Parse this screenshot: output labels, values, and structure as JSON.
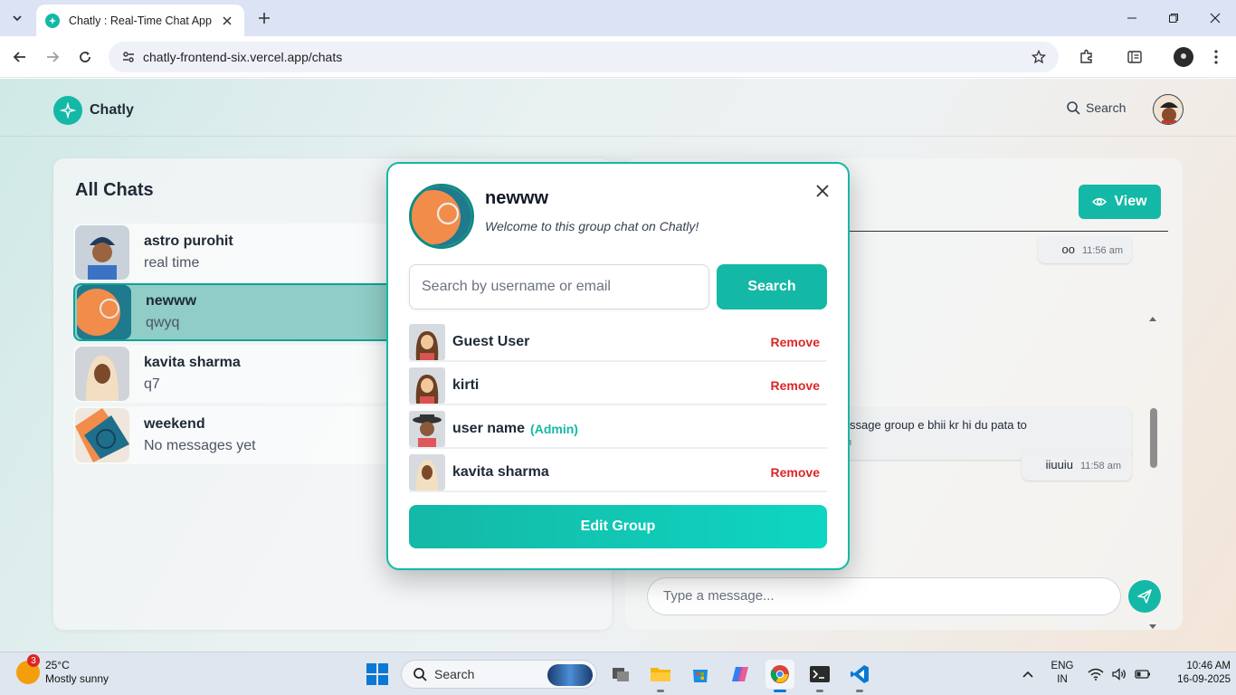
{
  "browser": {
    "tab_title": "Chatly : Real-Time Chat App",
    "url": "chatly-frontend-six.vercel.app/chats"
  },
  "app": {
    "brand": "Chatly",
    "header_search": "Search",
    "accent_color": "#14b8a6"
  },
  "chats": {
    "title": "All Chats",
    "items": [
      {
        "name": "astro purohit",
        "last": "real time",
        "avatar": "turbaned-man-avatar"
      },
      {
        "name": "newww",
        "last": "qwyq",
        "avatar": "group-avatar"
      },
      {
        "name": "kavita sharma",
        "last": "q7",
        "avatar": "woman-scarf-avatar"
      },
      {
        "name": "weekend",
        "last": "No messages yet",
        "avatar": "group-avatar"
      }
    ]
  },
  "messages": {
    "view_label": "View",
    "bubbles": [
      {
        "text": "oo",
        "time": "11:56 am"
      },
      {
        "text": "message group e bhii kr hi du pata to",
        "time": "m"
      },
      {
        "text": "iiuuiu",
        "time": "11:58 am"
      }
    ],
    "input_placeholder": "Type a message..."
  },
  "modal": {
    "group_name": "newww",
    "description": "Welcome to this group chat on Chatly!",
    "search_placeholder": "Search by username or email",
    "search_button": "Search",
    "members": [
      {
        "name": "Guest User",
        "action": "Remove",
        "admin": ""
      },
      {
        "name": "kirti",
        "action": "Remove",
        "admin": ""
      },
      {
        "name": "user name",
        "action": "",
        "admin": "(Admin)"
      },
      {
        "name": "kavita sharma",
        "action": "Remove",
        "admin": ""
      }
    ],
    "edit_button": "Edit Group"
  },
  "taskbar": {
    "weather_badge": "3",
    "temperature": "25°C",
    "condition": "Mostly sunny",
    "search": "Search",
    "lang_top": "ENG",
    "lang_bottom": "IN",
    "time": "10:46 AM",
    "date": "16-09-2025"
  }
}
